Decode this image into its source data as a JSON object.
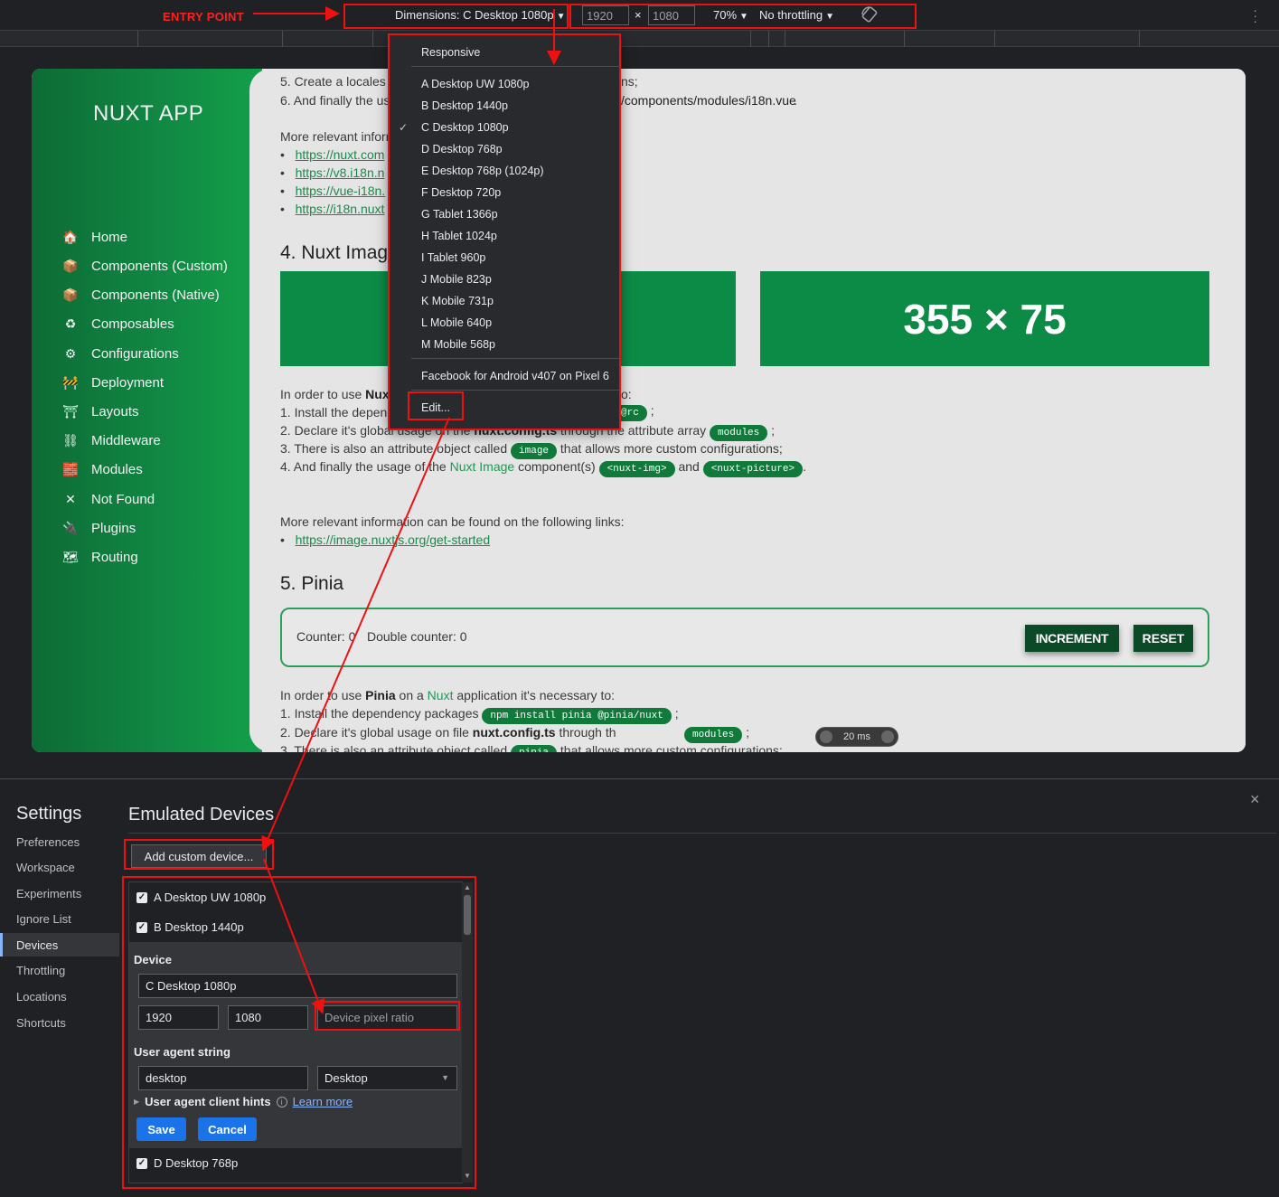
{
  "annotation": {
    "entry_point": "ENTRY POINT"
  },
  "toolbar": {
    "dimensions_label": "Dimensions: C Desktop 1080p",
    "width": "1920",
    "times": "×",
    "height": "1080",
    "zoom": "70%",
    "throttling": "No throttling",
    "rotate_icon": "rotate-icon",
    "more_icon": "more-vertical-icon"
  },
  "site": {
    "brand": "NUXT APP",
    "nav": [
      {
        "label": "Home",
        "icon": "home-icon",
        "glyph": "🏠"
      },
      {
        "label": "Components (Custom)",
        "icon": "components-icon",
        "glyph": "📦"
      },
      {
        "label": "Components (Native)",
        "icon": "components-native-icon",
        "glyph": "📦"
      },
      {
        "label": "Composables",
        "icon": "recycle-icon",
        "glyph": "♻"
      },
      {
        "label": "Configurations",
        "icon": "gear-icon",
        "glyph": "⚙"
      },
      {
        "label": "Deployment",
        "icon": "deployment-icon",
        "glyph": "🚧"
      },
      {
        "label": "Layouts",
        "icon": "layouts-icon",
        "glyph": "⛩"
      },
      {
        "label": "Middleware",
        "icon": "middleware-icon",
        "glyph": "⛓"
      },
      {
        "label": "Modules",
        "icon": "modules-icon",
        "glyph": "🧱"
      },
      {
        "label": "Not Found",
        "icon": "close-icon",
        "glyph": "✕"
      },
      {
        "label": "Plugins",
        "icon": "plugin-icon",
        "glyph": "🔌"
      },
      {
        "label": "Routing",
        "icon": "map-icon",
        "glyph": "🗺"
      }
    ],
    "content": {
      "l1": "5. Create a locales f",
      "l1b": "ns;",
      "l2": "6. And finally the us",
      "l2b": "/components/modules/i18n.vue",
      "l2c": ".",
      "more_info": "More relevant inforn",
      "links": [
        "https://nuxt.com",
        "https://v8.i18n.n",
        "https://vue-i18n.",
        "https://i18n.nuxt"
      ],
      "h4": "4.  Nuxt Imag",
      "img2": "355 × 75",
      "p1a": "In order to use",
      "p1b": "Nuxt",
      "p1c": "o:",
      "p2": "1. Install the depend",
      "p2pill": "@rc",
      "p2end": ";",
      "p3a": "2. Declare it's global usage on the",
      "p3b": "nuxt.config.ts",
      "p3c": "through the attribute array",
      "p3pill": "modules",
      "p3end": ";",
      "p4a": "3. There is also an attribute object called",
      "p4pill": "image",
      "p4b": "that allows more custom configurations;",
      "p5a": "4. And finally the usage of the",
      "p5b": "Nuxt Image",
      "p5c": "component(s)",
      "p5pill1": "<nuxt-img>",
      "p5d": "and",
      "p5pill2": "<nuxt-picture>",
      "p5end": ".",
      "more2": "More relevant information can be found on the following links:",
      "link2": "https://image.nuxtjs.org/get-started",
      "h5": "5.  Pinia",
      "counter": "Counter: 0",
      "double": "Double counter: 0",
      "increment": "INCREMENT",
      "reset": "RESET",
      "q1a": "In order to use",
      "q1b": "Pinia",
      "q1c": "on a",
      "q1d": "Nuxt",
      "q1e": "application it's necessary to:",
      "q2a": "1. Install the dependency packages",
      "q2pill": "npm install pinia @pinia/nuxt",
      "q2end": ";",
      "q3a": "2. Declare it's global usage on file",
      "q3b": "nuxt.config.ts",
      "q3c": "through th",
      "q3pill": "modules",
      "q3end": ";",
      "q4a": "3. There is also an attribute object called",
      "q4pill": "pinia",
      "q4b": "that allows more custom configurations;",
      "perf": "20 ms"
    }
  },
  "dropdown": {
    "responsive": "Responsive",
    "items": [
      "A Desktop UW 1080p",
      "B Desktop 1440p",
      "C Desktop 1080p",
      "D Desktop 768p",
      "E Desktop 768p (1024p)",
      "F Desktop 720p",
      "G Tablet 1366p",
      "H Tablet 1024p",
      "I Tablet 960p",
      "J Mobile 823p",
      "K Mobile 731p",
      "L Mobile 640p",
      "M Mobile 568p"
    ],
    "selected_index": 2,
    "check": "✓",
    "facebook": "Facebook for Android v407 on Pixel 6",
    "edit": "Edit..."
  },
  "settings": {
    "title": "Settings",
    "nav": [
      "Preferences",
      "Workspace",
      "Experiments",
      "Ignore List",
      "Devices",
      "Throttling",
      "Locations",
      "Shortcuts"
    ],
    "active": "Devices",
    "panel_title": "Emulated Devices",
    "close": "×",
    "add_custom": "Add custom device...",
    "devices_top": [
      "A Desktop UW 1080p",
      "B Desktop 1440p"
    ],
    "device_label": "Device",
    "device_name": "C Desktop 1080p",
    "dev_width": "1920",
    "dev_height": "1080",
    "dpr_placeholder": "Device pixel ratio",
    "ua_label": "User agent string",
    "ua_value": "desktop",
    "ua_type": "Desktop",
    "ua_hints": "User agent client hints",
    "learn_more": "Learn more",
    "save": "Save",
    "cancel": "Cancel",
    "devices_bottom": [
      "D Desktop 768p"
    ],
    "checkmark": "✓"
  },
  "colors": {
    "annotation_red": "#e11111",
    "nuxt_green": "#0c8b47",
    "devtools_blue": "#1a73e8"
  }
}
